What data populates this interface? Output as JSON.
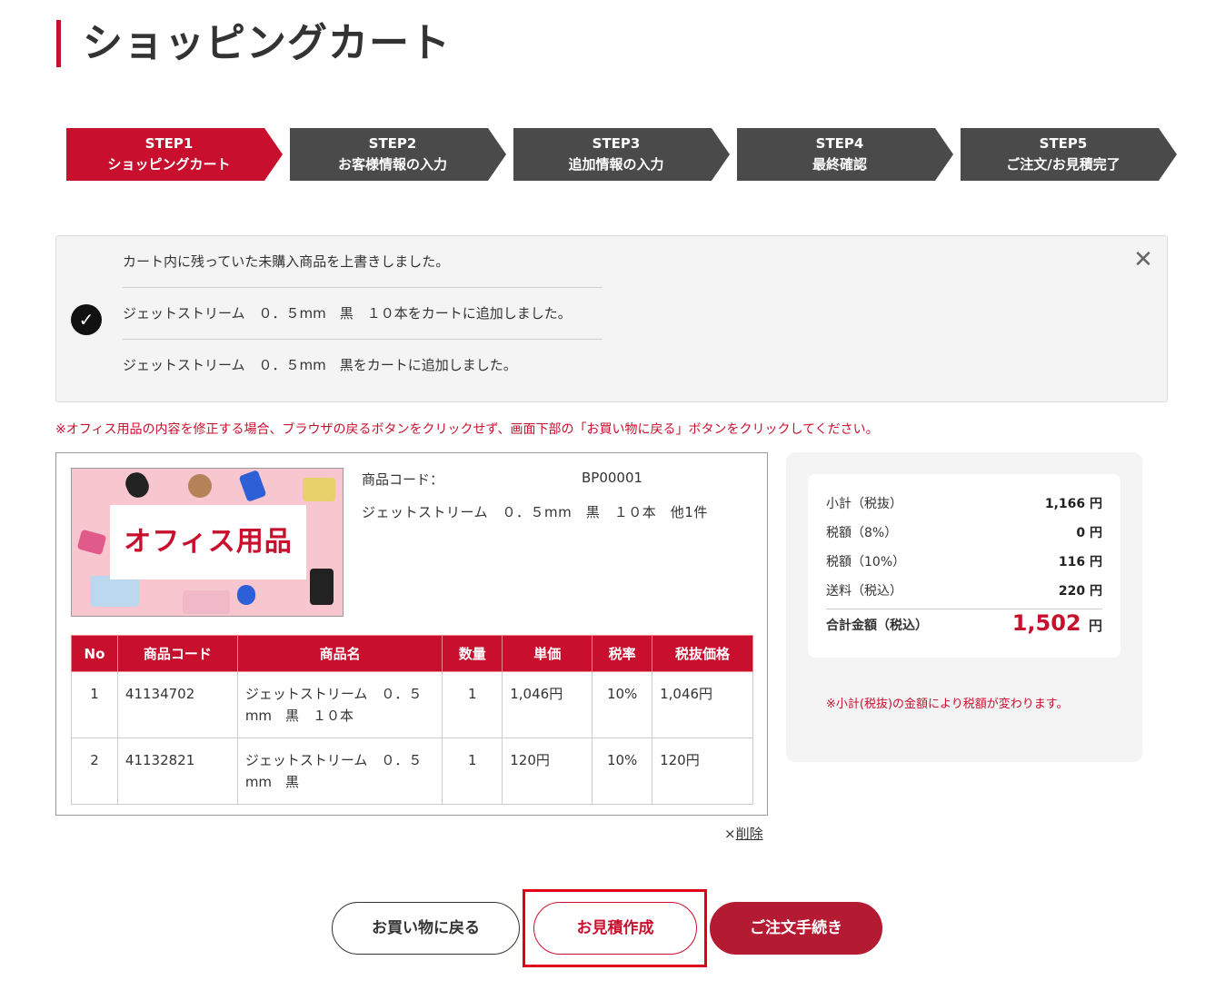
{
  "page": {
    "title": "ショッピングカート"
  },
  "steps": [
    {
      "num": "STEP1",
      "label": "ショッピングカート"
    },
    {
      "num": "STEP2",
      "label": "お客様情報の入力"
    },
    {
      "num": "STEP3",
      "label": "追加情報の入力"
    },
    {
      "num": "STEP4",
      "label": "最終確認"
    },
    {
      "num": "STEP5",
      "label": "ご注文/お見積完了"
    }
  ],
  "notice": {
    "messages": [
      "カート内に残っていた未購入商品を上書きしました。",
      "ジェットストリーム　０．５mm　黒　１０本をカートに追加しました。",
      "ジェットストリーム　０．５mm　黒をカートに追加しました。"
    ],
    "close_glyph": "✕",
    "check_glyph": "✓"
  },
  "warning": "※オフィス用品の内容を修正する場合、ブラウザの戻るボタンをクリックせず、画面下部の「お買い物に戻る」ボタンをクリックしてください。",
  "product": {
    "banner_text": "オフィス用品",
    "code_label": "商品コード：",
    "code_value": "BP00001",
    "name": "ジェットストリーム　０．５mm　黒　１０本　他1件"
  },
  "table": {
    "headers": [
      "No",
      "商品コード",
      "商品名",
      "数量",
      "単価",
      "税率",
      "税抜価格"
    ],
    "rows": [
      {
        "no": "1",
        "code": "41134702",
        "name": "ジェットストリーム　０．５mm　黒　１０本",
        "qty": "1",
        "unit": "1,046円",
        "rate": "10%",
        "price": "1,046円"
      },
      {
        "no": "2",
        "code": "41132821",
        "name": "ジェットストリーム　０．５mm　黒",
        "qty": "1",
        "unit": "120円",
        "rate": "10%",
        "price": "120円"
      }
    ]
  },
  "delete": {
    "prefix": "×",
    "label": "削除"
  },
  "summary": {
    "rows": [
      {
        "label": "小計（税抜）",
        "value": "1,166 円"
      },
      {
        "label": "税額（8%）",
        "value": "0 円"
      },
      {
        "label": "税額（10%）",
        "value": "116 円"
      },
      {
        "label": "送料（税込）",
        "value": "220 円"
      }
    ],
    "total_label": "合計金額（税込）",
    "total_value": "1,502",
    "total_unit": "円",
    "note": "※小計(税抜)の金額により税額が変わります。"
  },
  "buttons": {
    "back": "お買い物に戻る",
    "quote": "お見積作成",
    "order": "ご注文手続き"
  },
  "colors": {
    "accent": "#c8102e",
    "step_inactive": "#4a4a4a",
    "order_button": "#b51a33"
  }
}
